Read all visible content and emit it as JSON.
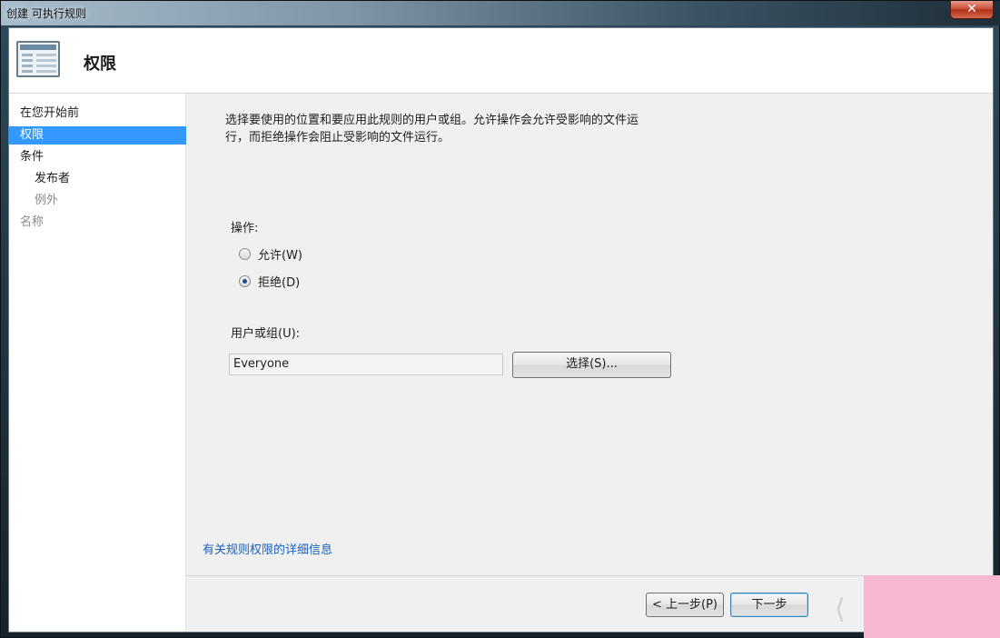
{
  "window": {
    "title": "创建 可执行规则",
    "close_glyph": "✕"
  },
  "header": {
    "title": "权限",
    "icon": "wizard-page-icon"
  },
  "nav": {
    "items": [
      {
        "label": "在您开始前",
        "state": "normal"
      },
      {
        "label": "权限",
        "state": "selected"
      },
      {
        "label": "条件",
        "state": "normal"
      },
      {
        "label": "发布者",
        "state": "sub"
      },
      {
        "label": "例外",
        "state": "sub-disabled"
      },
      {
        "label": "名称",
        "state": "disabled"
      }
    ]
  },
  "main": {
    "description": "选择要使用的位置和要应用此规则的用户或组。允许操作会允许受影响的文件运行，而拒绝操作会阻止受影响的文件运行。",
    "action_label": "操作:",
    "allow_label": "允许(W)",
    "deny_label": "拒绝(D)",
    "selected_action": "deny",
    "user_group_label": "用户或组(U):",
    "user_group_value": "Everyone",
    "select_button": "选择(S)...",
    "info_link": "有关规则权限的详细信息"
  },
  "footer": {
    "back_button": "< 上一步(P)",
    "next_button": "下一步"
  },
  "colors": {
    "selection": "#3399ff",
    "link": "#1a62b8",
    "overlay": "#f6b7d0"
  }
}
